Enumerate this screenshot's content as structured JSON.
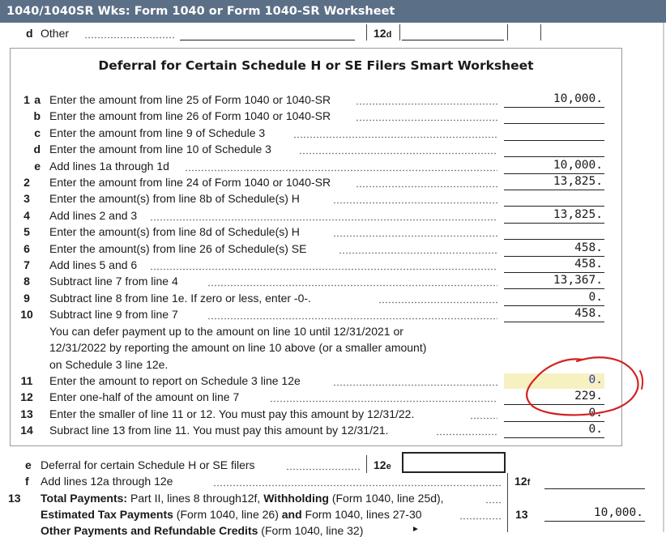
{
  "window": {
    "title": "1040/1040SR Wks: Form 1040 or Form 1040-SR Worksheet"
  },
  "top": {
    "d_label": "d",
    "d_text": "Other",
    "line12d_num": "12",
    "line12d_sub": "d"
  },
  "worksheet": {
    "title": "Deferral for Certain Schedule H or SE Filers Smart Worksheet",
    "lines": [
      {
        "num": "1",
        "sub": "a",
        "text": "Enter the amount from line 25 of Form 1040 or 1040-SR",
        "value": "10,000."
      },
      {
        "num": "",
        "sub": "b",
        "text": "Enter the amount from line 26 of Form 1040 or 1040-SR",
        "value": ""
      },
      {
        "num": "",
        "sub": "c",
        "text": "Enter the amount from line 9 of Schedule 3",
        "value": ""
      },
      {
        "num": "",
        "sub": "d",
        "text": "Enter the amount from line 10 of Schedule 3",
        "value": ""
      },
      {
        "num": "",
        "sub": "e",
        "text": "Add lines 1a through 1d",
        "value": "10,000."
      },
      {
        "num": "2",
        "sub": "",
        "text": "Enter the amount from line 24 of Form 1040 or 1040-SR",
        "value": "13,825."
      },
      {
        "num": "3",
        "sub": "",
        "text": "Enter the amount(s) from line 8b of Schedule(s) H",
        "value": ""
      },
      {
        "num": "4",
        "sub": "",
        "text": "Add lines 2 and 3",
        "value": "13,825."
      },
      {
        "num": "5",
        "sub": "",
        "text": "Enter the amount(s) from line 8d of Schedule(s) H",
        "value": ""
      },
      {
        "num": "6",
        "sub": "",
        "text": "Enter the amount(s) from line 26 of Schedule(s) SE",
        "value": "458."
      },
      {
        "num": "7",
        "sub": "",
        "text": "Add lines 5 and 6",
        "value": "458."
      },
      {
        "num": "8",
        "sub": "",
        "text": "Subtract line 7 from line 4",
        "value": "13,367."
      },
      {
        "num": "9",
        "sub": "",
        "text": "Subtract line 8 from line 1e. If zero or less, enter -0-.",
        "value": "0."
      },
      {
        "num": "10",
        "sub": "",
        "text": "Subtract line 9 from line 7",
        "value": "458."
      }
    ],
    "note": [
      "You can defer payment up to the amount on line 10 until 12/31/2021 or",
      "12/31/2022 by reporting the amount on line 10 above (or a smaller amount)",
      "on Schedule 3 line 12e."
    ],
    "lines2": [
      {
        "num": "11",
        "text": "Enter the amount to report on Schedule 3 line 12e",
        "value": "0."
      },
      {
        "num": "12",
        "text": "Enter one-half of the amount on line 7",
        "value": "229."
      },
      {
        "num": "13",
        "text": "Enter the smaller of line 11 or 12. You must pay this amount by 12/31/22.",
        "value": "0."
      },
      {
        "num": "14",
        "text": "Subract line 13 from line 11. You must pay this amount by 12/31/21.",
        "value": "0."
      }
    ]
  },
  "bottom": {
    "e_label": "e",
    "e_text": "Deferral for certain Schedule H or SE filers",
    "e_num": "12",
    "e_sub": "e",
    "f_label": "f",
    "f_text": "Add lines 12a through 12e",
    "f_num": "12",
    "f_sub": "f",
    "line13_num": "13",
    "line13_bold1": "Total Payments:",
    "line13_text1": " Part II, lines 8 through12f, ",
    "line13_bold2": "Withholding",
    "line13_text2": " (Form 1040, line 25d),",
    "line13b_bold1": "Estimated Tax Payments",
    "line13b_text1": "  (Form 1040, line 26) ",
    "line13b_bold2": "and",
    "line13b_text2": " Form 1040, lines 27-30",
    "line13_box": "13",
    "line13_value": "10,000.",
    "line14_bold": "Other Payments and Refundable Credits",
    "line14_text": " (Form 1040, line 32)"
  },
  "colors": {
    "titlebar": "#5b6f87",
    "highlight": "#f7f0c0",
    "annotation": "#d42020",
    "value_blue": "#2a3aa8"
  }
}
